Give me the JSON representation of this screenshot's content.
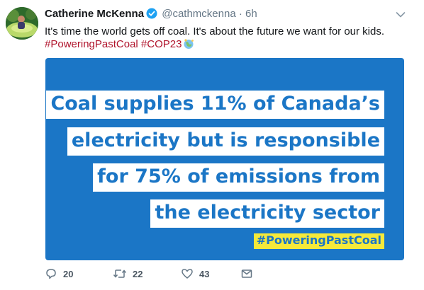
{
  "tweet": {
    "author_name": "Catherine McKenna",
    "handle": "@cathmckenna",
    "separator": "·",
    "time": "6h",
    "text": "It's time the world gets off coal. It's about the future we want for our kids.",
    "hashtags": [
      "#PoweringPastCoal",
      "#COP23"
    ],
    "icons": {
      "verified": "verified-badge-icon",
      "caret": "chevron-down-icon",
      "emoji": "globe-emoji-icon"
    }
  },
  "card": {
    "lines": [
      "Coal supplies 11% of Canada’s",
      "electricity but is responsible",
      "for 75% of emissions from",
      "the electricity sector"
    ],
    "tag": "#PoweringPastCoal",
    "colors": {
      "background": "#1b76c6",
      "text_box": "#ffffff",
      "tag_box": "#f5e93a"
    }
  },
  "actions": {
    "reply_count": "20",
    "retweet_count": "22",
    "like_count": "43"
  }
}
